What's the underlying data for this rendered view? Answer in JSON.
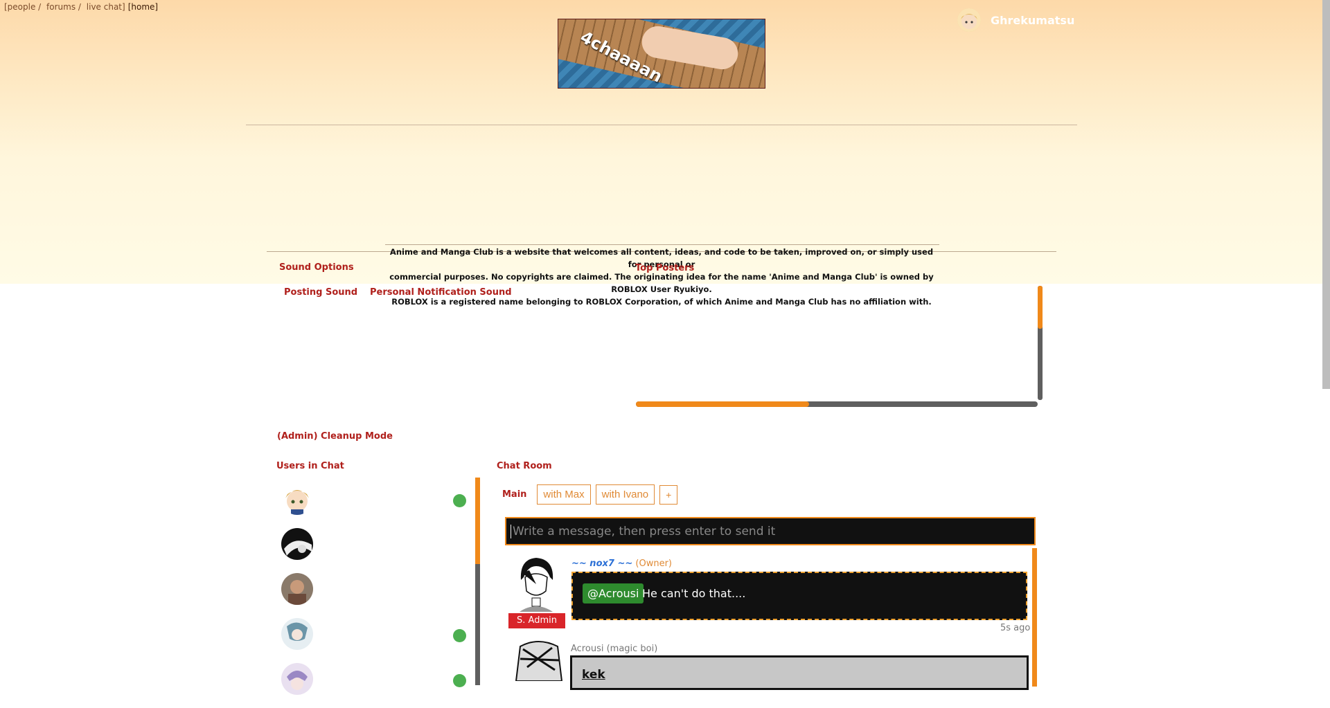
{
  "breadcrumb": {
    "items": [
      "[people /",
      "forums /",
      "live chat]",
      "[home]"
    ]
  },
  "user": {
    "name": "Ghrekumatsu"
  },
  "banner": {
    "logo_text": "4chaaaan"
  },
  "disclaimer": {
    "lines": [
      "Anime and Manga Club is a website that welcomes all content, ideas, and code to be taken, improved on, or simply used for personal or",
      "commercial purposes. No copyrights are claimed. The originating idea for the name 'Anime and Manga Club' is owned by ROBLOX User Ryukiyo.",
      "ROBLOX is a registered name belonging to ROBLOX Corporation, of which Anime and Manga Club has no affiliation with."
    ]
  },
  "links": {
    "sound_options": "Sound Options",
    "top_posters": "Top Posters",
    "posting_sound": "Posting Sound",
    "personal_notification_sound": "Personal Notification Sound",
    "cleanup_mode": "(Admin) Cleanup Mode"
  },
  "sections": {
    "users_in_chat": "Users in Chat",
    "chat_room": "Chat Room"
  },
  "users": [
    {
      "online": true
    },
    {
      "online": false
    },
    {
      "online": false
    },
    {
      "online": true
    },
    {
      "online": true
    }
  ],
  "tabs": {
    "main": "Main",
    "items": [
      "with Max",
      "with Ivano"
    ],
    "add": "+"
  },
  "message_input": {
    "placeholder": "Write a message, then press enter to send it"
  },
  "posts": [
    {
      "name": "~~ nox7 ~~",
      "role_prefix": "(",
      "role": "Owner",
      "role_suffix": ")",
      "rank": "S. Admin",
      "mention": "@Acrousi",
      "text": "He can't do that....",
      "time": "5s ago"
    },
    {
      "name": "Acrousi (magic boi)",
      "text": "kek"
    }
  ],
  "colors": {
    "accent": "#f0891a",
    "link": "#b0201c",
    "online": "#4caf50",
    "rank_badge": "#d9252a",
    "mention": "#2e8b2e"
  }
}
